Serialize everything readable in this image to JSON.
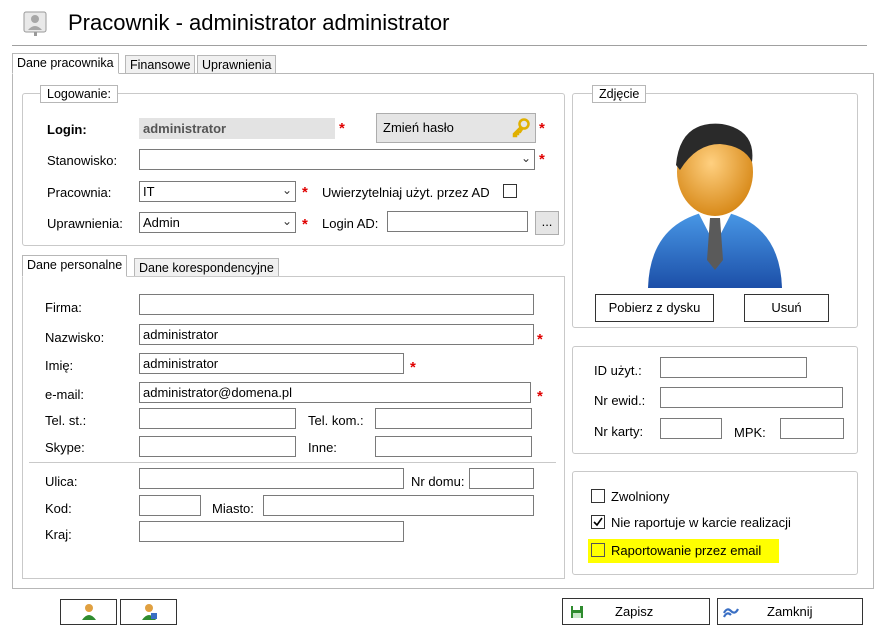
{
  "window": {
    "title": "Pracownik - administrator administrator",
    "icon": "user-card-icon"
  },
  "tabs": {
    "main": [
      "Dane pracownika",
      "Finansowe",
      "Uprawnienia"
    ],
    "sub": [
      "Dane personalne",
      "Dane korespondencyjne"
    ]
  },
  "login_group": {
    "legend": "Logowanie:",
    "login_label": "Login:",
    "login_value": "administrator",
    "change_password": "Zmień hasło",
    "position_label": "Stanowisko:",
    "position_value": "",
    "studio_label": "Pracownia:",
    "studio_value": "IT",
    "ad_auth_label": "Uwierzytelniaj użyt. przez AD",
    "permissions_label": "Uprawnienia:",
    "permissions_value": "Admin",
    "login_ad_label": "Login AD:",
    "login_ad_value": "",
    "browse_label": "..."
  },
  "personal": {
    "company_label": "Firma:",
    "company_value": "",
    "surname_label": "Nazwisko:",
    "surname_value": "administrator",
    "firstname_label": "Imię:",
    "firstname_value": "administrator",
    "email_label": "e-mail:",
    "email_value": "administrator@domena.pl",
    "phone_label": "Tel. st.:",
    "phone_value": "",
    "mobile_label": "Tel. kom.:",
    "mobile_value": "",
    "skype_label": "Skype:",
    "skype_value": "",
    "other_label": "Inne:",
    "other_value": "",
    "street_label": "Ulica:",
    "street_value": "",
    "house_label": "Nr domu:",
    "house_value": "",
    "postcode_label": "Kod:",
    "postcode_value": "",
    "city_label": "Miasto:",
    "city_value": "",
    "country_label": "Kraj:",
    "country_value": ""
  },
  "photo": {
    "legend": "Zdjęcie",
    "load_button": "Pobierz z dysku",
    "remove_button": "Usuń"
  },
  "ids": {
    "user_id_label": "ID użyt.:",
    "user_id_value": "",
    "record_label": "Nr ewid.:",
    "record_value": "",
    "card_label": "Nr karty:",
    "card_value": "",
    "mpk_label": "MPK:",
    "mpk_value": ""
  },
  "flags": {
    "dismissed_label": "Zwolniony",
    "dismissed": false,
    "no_report_label": "Nie raportuje w karcie realizacji",
    "no_report": true,
    "email_report_label": "Raportowanie przez email",
    "email_report": false,
    "highlight_color": "#ffff00"
  },
  "footer": {
    "save_label": "Zapisz",
    "close_label": "Zamknij"
  },
  "colors": {
    "required": "#e00000",
    "key": "#e0b000",
    "save_icon": "#2e8b2e",
    "close_icon": "#3a6fc4"
  }
}
